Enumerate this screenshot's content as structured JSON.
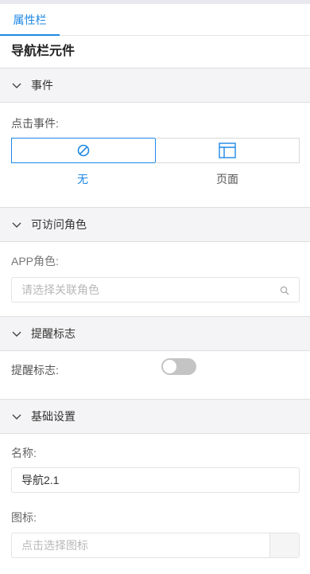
{
  "tabs": {
    "properties": "属性栏"
  },
  "component_title": "导航栏元件",
  "sections": {
    "event": {
      "title": "事件",
      "label": "点击事件:",
      "options": [
        {
          "label": "无",
          "icon": "no-link-icon"
        },
        {
          "label": "页面",
          "icon": "page-layout-icon"
        }
      ]
    },
    "roles": {
      "title": "可访问角色",
      "label": "APP角色:",
      "placeholder": "请选择关联角色"
    },
    "badge": {
      "title": "提醒标志",
      "label": "提醒标志:"
    },
    "basic": {
      "title": "基础设置",
      "name_label": "名称:",
      "name_value": "导航2.1",
      "icon_label": "图标:",
      "icon_placeholder": "点击选择图标"
    }
  },
  "colors": {
    "accent": "#1e88e5",
    "section_bg": "#f4f4f6",
    "toggle_off": "#c4c4c4"
  }
}
